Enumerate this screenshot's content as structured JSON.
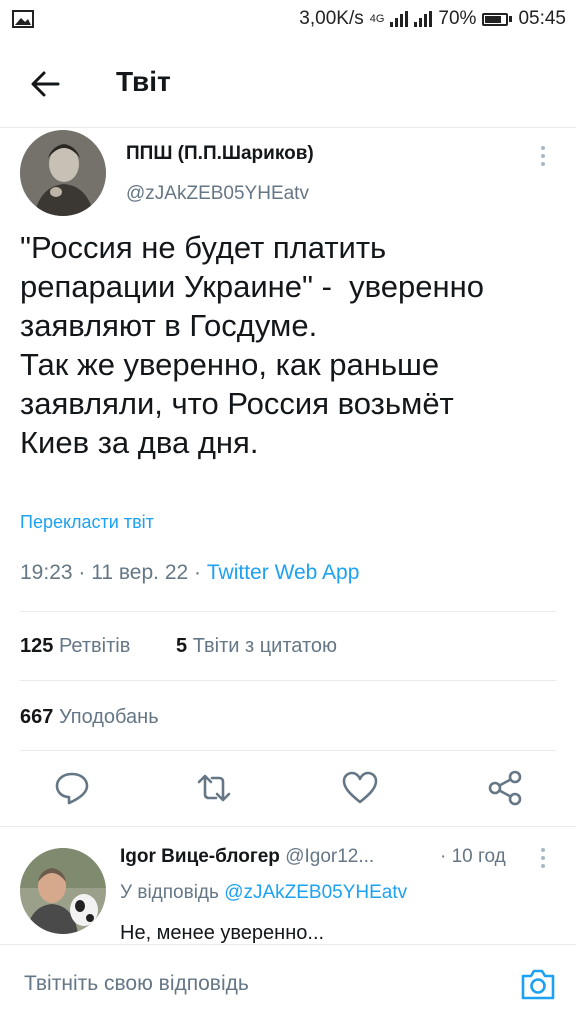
{
  "status_bar": {
    "speed": "3,00K/s",
    "network": "4G",
    "battery": "70%",
    "time": "05:45"
  },
  "header": {
    "title": "Твіт"
  },
  "tweet": {
    "name": "ППШ (П.П.Шариков)",
    "handle": "@zJAkZEB05YHEatv",
    "text_lines": [
      "\"Россия не будет платить",
      "репарации Украине\" -  уверенно",
      "заявляют в Госдуме.",
      "Так же уверенно, как раньше",
      "заявляли, что Россия возьмёт",
      "Киев за два дня."
    ],
    "translate": "Перекласти твіт",
    "time": "19:23",
    "date": "11 вер. 22",
    "source": "Twitter Web App",
    "retweets_count": "125",
    "retweets_label": "Ретвітів",
    "quotes_count": "5",
    "quotes_label": "Твіти з цитатою",
    "likes_count": "667",
    "likes_label": "Уподобань"
  },
  "reply": {
    "name": "Igor Вице-блогер",
    "handle": "@Igor12...",
    "time": "10 год",
    "replying_to_label": "У відповідь",
    "replying_to_handle": "@zJAkZEB05YHEatv",
    "text": "Не, менее уверенно..."
  },
  "compose": {
    "placeholder": "Твітніть свою відповідь"
  },
  "colors": {
    "accent": "#1da1f2",
    "secondary_text": "#657786",
    "divider": "#e6ecf0"
  },
  "icons": [
    "image-icon",
    "signal-icon",
    "battery-icon",
    "back-arrow-icon",
    "more-icon",
    "reply-icon",
    "retweet-icon",
    "like-icon",
    "share-icon",
    "camera-icon"
  ]
}
